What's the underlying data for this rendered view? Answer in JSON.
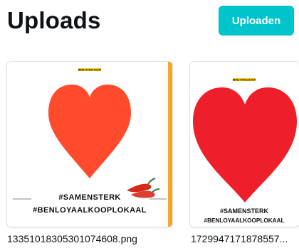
{
  "header": {
    "title": "Uploads",
    "upload_button_label": "Uploaden"
  },
  "colors": {
    "accent": "#00c4cc",
    "heart_1": "#ff4a2c",
    "heart_2": "#ee1f2a",
    "card_1_edge": "#f5a623",
    "pepper": "#d62a1a"
  },
  "uploads": [
    {
      "file_name": "1335101830530107460​8.png",
      "logo_text": "BENLOYAALKOOP",
      "tagline_1": "#SAMENSTERK",
      "tagline_2": "#BENLOYAALKOOPLOKAAL",
      "decoration_icon": "chili-pepper-icon"
    },
    {
      "file_name": "1729947171878557...",
      "logo_text": "BENLOYAALKOOP",
      "tagline_1": "#SAMENSTERK",
      "tagline_2": "#BENLOYAALKOOPLOKAAL"
    }
  ]
}
